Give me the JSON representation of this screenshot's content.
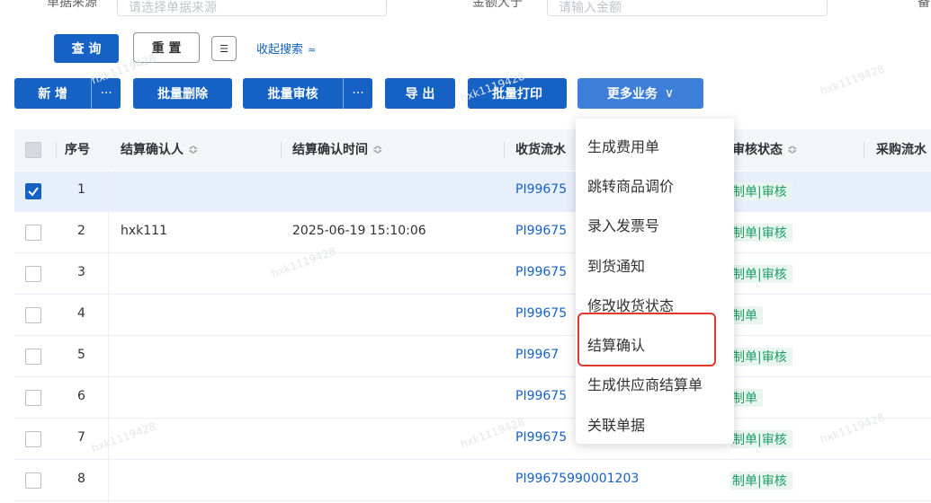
{
  "filters": {
    "source_label": "单据来源",
    "source_placeholder": "请选择单据来源",
    "amount_label": "金额大于",
    "amount_placeholder": "请输入金额",
    "extra_label": "备"
  },
  "search_buttons": {
    "query": "查 询",
    "reset": "重 置",
    "collapse_link": "收起搜索",
    "collapse_icon": "chevron-double-up-icon"
  },
  "toolbar": {
    "add": "新 增",
    "more_dots": "···",
    "batch_delete": "批量删除",
    "batch_review": "批量审核",
    "review_dots": "···",
    "export": "导 出",
    "batch_print": "批量打印",
    "more_business": "更多业务",
    "more_icon": "chevron-down-icon"
  },
  "table": {
    "columns": [
      "序号",
      "结算确认人",
      "结算确认时间",
      "收货流水",
      "审核状态",
      "采购流水"
    ],
    "rows": [
      {
        "index": "1",
        "confirmer": "",
        "time": "",
        "receipt": "PI99675",
        "status": "制单|审核",
        "checked": true
      },
      {
        "index": "2",
        "confirmer": "hxk111",
        "time": "2025-06-19 15:10:06",
        "receipt": "PI99675",
        "status": "制单|审核",
        "checked": false
      },
      {
        "index": "3",
        "confirmer": "",
        "time": "",
        "receipt": "PI99675",
        "status": "制单|审核",
        "checked": false
      },
      {
        "index": "4",
        "confirmer": "",
        "time": "",
        "receipt": "PI99675",
        "status": "制单",
        "checked": false
      },
      {
        "index": "5",
        "confirmer": "",
        "time": "",
        "receipt": "PI9967",
        "status": "制单|审核",
        "checked": false
      },
      {
        "index": "6",
        "confirmer": "",
        "time": "",
        "receipt": "PI99675",
        "status": "制单",
        "checked": false
      },
      {
        "index": "7",
        "confirmer": "",
        "time": "",
        "receipt": "PI99675",
        "status": "制单|审核",
        "checked": false
      },
      {
        "index": "8",
        "confirmer": "",
        "time": "",
        "receipt": "PI99675990001203",
        "status": "制单|审核",
        "checked": false
      }
    ]
  },
  "dropdown": {
    "items": [
      "生成费用单",
      "跳转商品调价",
      "录入发票号",
      "到货通知",
      "修改收货状态",
      "结算确认",
      "生成供应商结算单",
      "关联单据"
    ],
    "highlighted": "结算确认"
  },
  "watermark": "hxk1119428",
  "colors": {
    "primary": "#1561c4",
    "status_green": "#1e9e6a",
    "highlight_red": "#e0392b"
  }
}
